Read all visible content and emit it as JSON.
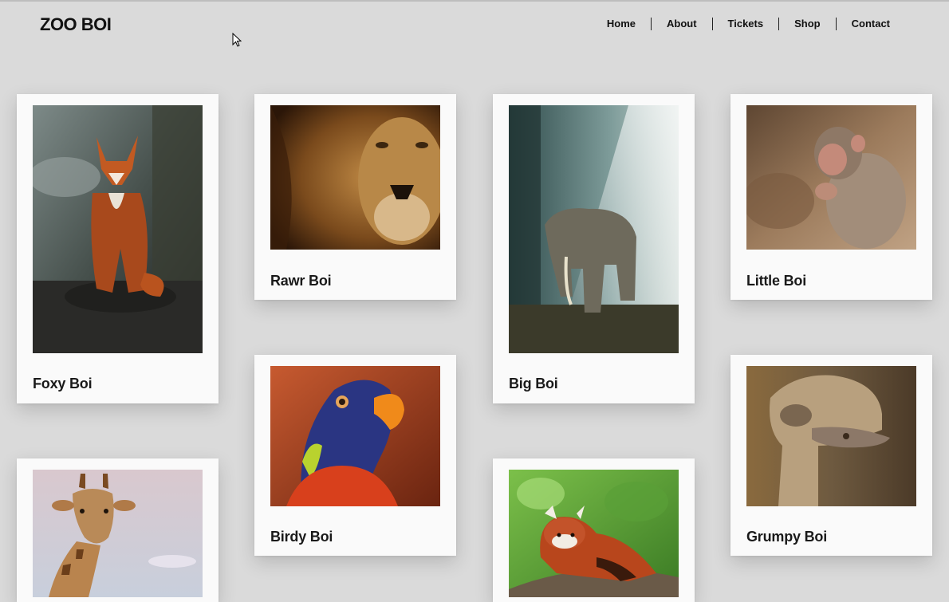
{
  "header": {
    "logo": "ZOO BOI",
    "nav": [
      {
        "label": "Home"
      },
      {
        "label": "About"
      },
      {
        "label": "Tickets"
      },
      {
        "label": "Shop"
      },
      {
        "label": "Contact"
      }
    ]
  },
  "gallery": {
    "cards": [
      {
        "title": "Foxy Boi",
        "image": "fox-photo"
      },
      {
        "title": "Rawr Boi",
        "image": "lion-photo"
      },
      {
        "title": "Big Boi",
        "image": "elephant-photo"
      },
      {
        "title": "Little Boi",
        "image": "monkey-photo"
      },
      {
        "title": "Birdy Boi",
        "image": "parrot-photo"
      },
      {
        "title": "Grumpy Boi",
        "image": "ostrich-photo"
      },
      {
        "title": "",
        "image": "giraffe-photo"
      },
      {
        "title": "",
        "image": "red-panda-photo"
      }
    ]
  },
  "colors": {
    "page_background": "#dadada",
    "card_background": "#fafafa",
    "text": "#111111"
  }
}
